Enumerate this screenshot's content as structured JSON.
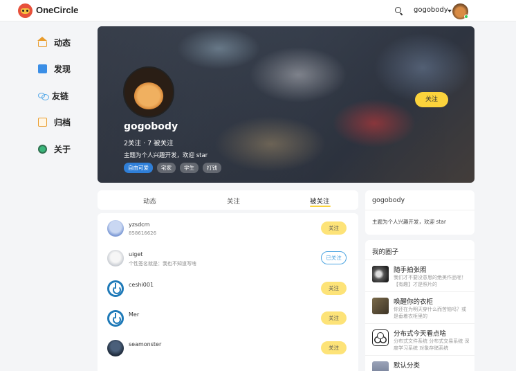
{
  "app": {
    "brand": "OneCircle"
  },
  "header": {
    "username": "gogobody"
  },
  "nav": {
    "items": [
      {
        "label": "动态",
        "icon": "home-icon"
      },
      {
        "label": "发现",
        "icon": "discover-icon"
      },
      {
        "label": "友链",
        "icon": "link-icon"
      },
      {
        "label": "归档",
        "icon": "archive-icon"
      },
      {
        "label": "关于",
        "icon": "about-icon"
      }
    ]
  },
  "profile": {
    "name": "gogobody",
    "stats": "2关注 · 7 被关注",
    "bio": "主题为个人兴趣开发，欢迎 star",
    "tags": [
      "自由可爱",
      "宅家",
      "学生",
      "打钱"
    ],
    "follow_label": "关注"
  },
  "tabs": {
    "items": [
      {
        "label": "动态"
      },
      {
        "label": "关注"
      },
      {
        "label": "被关注"
      }
    ]
  },
  "followers": [
    {
      "name": "yzsdcm",
      "sub": "858616626",
      "action": "关注"
    },
    {
      "name": "uiget",
      "sub": "个性签名就是：我也不知道写啥",
      "action": "已关注"
    },
    {
      "name": "ceshi001",
      "sub": "",
      "action": "关注"
    },
    {
      "name": "Mer",
      "sub": "",
      "action": "关注"
    },
    {
      "name": "seamonster",
      "sub": "",
      "action": "关注"
    }
  ],
  "side": {
    "profile_name": "gogobody",
    "profile_bio": "主题为个人兴趣开发，欢迎 star",
    "circles_title": "我的圈子",
    "circles": [
      {
        "name": "随手拍张照",
        "desc": "我们才不要没意思的绝美作品呢！【有趣】才是照片的"
      },
      {
        "name": "唤醒你的衣柜",
        "desc": "你还在为明天穿什么而苦恼吗？或是垂着衣柜里的"
      },
      {
        "name": "分布式今天看点啥",
        "desc": "分布式文件系统 分布式交易系统 深度学习系统 对象存储系统"
      },
      {
        "name": "默认分类",
        "desc": ""
      }
    ]
  },
  "colors": {
    "accent": "#fbd33c",
    "link_blue": "#4aa3e0"
  }
}
